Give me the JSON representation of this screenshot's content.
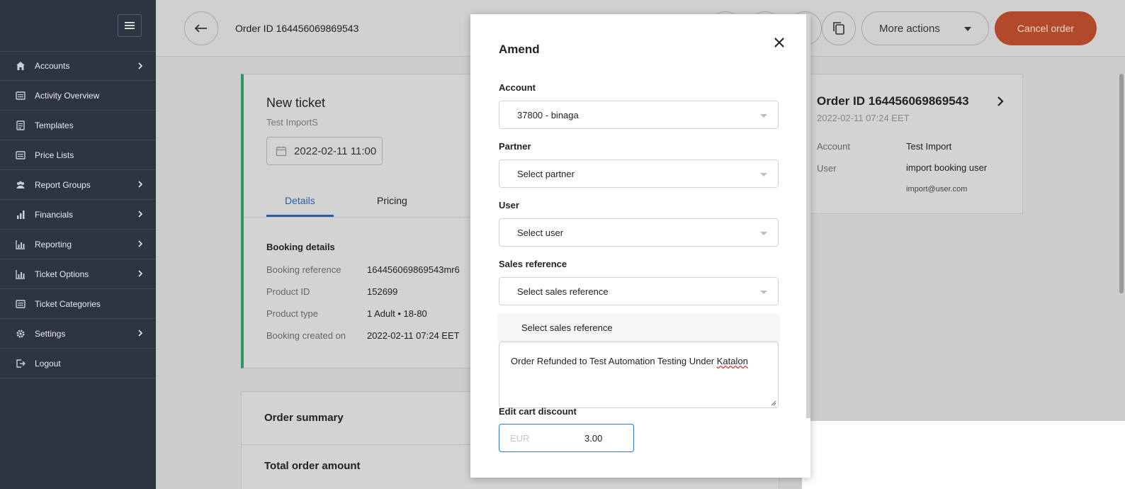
{
  "sidebar": {
    "menu_icon": "hamburger-icon",
    "items": [
      {
        "label": "Accounts",
        "icon": "home-icon",
        "has_submenu": true
      },
      {
        "label": "Activity Overview",
        "icon": "list-icon",
        "has_submenu": false
      },
      {
        "label": "Templates",
        "icon": "document-icon",
        "has_submenu": false
      },
      {
        "label": "Price Lists",
        "icon": "list-icon",
        "has_submenu": false
      },
      {
        "label": "Report Groups",
        "icon": "users-icon",
        "has_submenu": true
      },
      {
        "label": "Financials",
        "icon": "bar-chart-icon",
        "has_submenu": true
      },
      {
        "label": "Reporting",
        "icon": "chart-icon",
        "has_submenu": true
      },
      {
        "label": "Ticket Options",
        "icon": "chart-icon",
        "has_submenu": true
      },
      {
        "label": "Ticket Categories",
        "icon": "list-icon",
        "has_submenu": false
      },
      {
        "label": "Settings",
        "icon": "gear-icon",
        "has_submenu": true
      },
      {
        "label": "Logout",
        "icon": "logout-icon",
        "has_submenu": false
      }
    ]
  },
  "header": {
    "order_title": "Order ID 164456069869543",
    "more_actions_label": "More actions",
    "cancel_order_label": "Cancel order"
  },
  "ticket": {
    "title": "New ticket",
    "subtitle": "Test ImportS",
    "date": "2022-02-11 11:00",
    "tabs": [
      "Details",
      "Pricing"
    ],
    "booking_heading": "Booking details",
    "rows": [
      {
        "label": "Booking reference",
        "value": "164456069869543mr6"
      },
      {
        "label": "Product ID",
        "value": "152699"
      },
      {
        "label": "Product type",
        "value": "1 Adult • 18-80"
      },
      {
        "label": "Booking created on",
        "value": "2022-02-11 07:24 EET"
      }
    ]
  },
  "summary": {
    "order_summary": "Order summary",
    "total_order_amount": "Total order amount"
  },
  "order_card": {
    "title": "Order ID 164456069869543",
    "date": "2022-02-11 07:24 EET",
    "account_label": "Account",
    "account_value": "Test Import",
    "user_label": "User",
    "user_value": "import booking user",
    "user_email": "import@user.com"
  },
  "modal": {
    "title": "Amend",
    "account_label": "Account",
    "account_value": "37800 - binaga",
    "partner_label": "Partner",
    "partner_value": "Select partner",
    "user_label": "User",
    "user_value": "Select user",
    "sales_ref_label": "Sales reference",
    "sales_ref_value": "Select sales reference",
    "dropdown_option": "Select sales reference",
    "comment_text_a": "Order Refunded to Test Automation Testing Under ",
    "comment_text_b": "Katalon",
    "discount_label": "Edit cart discount",
    "discount_currency": "EUR",
    "discount_value": "3.00"
  },
  "colors": {
    "sidebar_bg": "#2e3542",
    "accent_blue": "#2b7bd6",
    "cancel_orange": "#e8542c",
    "ticket_green": "#2f9a60"
  }
}
